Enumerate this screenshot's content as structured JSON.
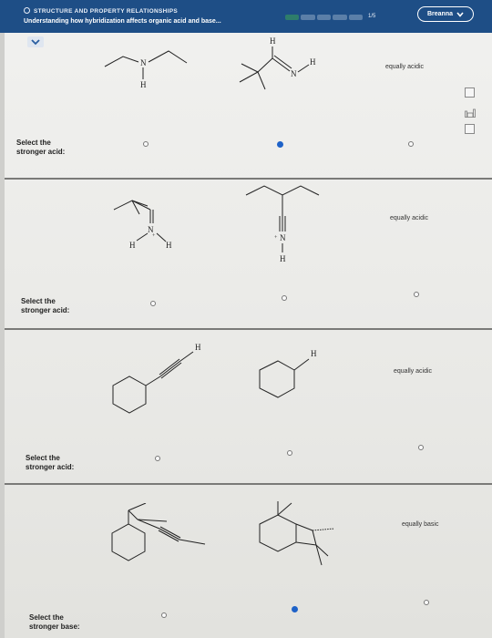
{
  "header": {
    "topic": "STRUCTURE AND PROPERTY RELATIONSHIPS",
    "subtitle": "Understanding how hybridization affects organic acid and base...",
    "progress_value": 0.2,
    "progress_label": "1/5",
    "user_name": "Breanna"
  },
  "questions": [
    {
      "prompt_line1": "Select the",
      "prompt_line2": "stronger acid:",
      "option_c": "equally acidic",
      "selected": "b"
    },
    {
      "prompt_line1": "Select the",
      "prompt_line2": "stronger acid:",
      "option_c": "equally acidic",
      "selected": null
    },
    {
      "prompt_line1": "Select the",
      "prompt_line2": "stronger acid:",
      "option_c": "equally acidic",
      "selected": null
    },
    {
      "prompt_line1": "Select the",
      "prompt_line2": "stronger base:",
      "option_c": "equally basic",
      "selected": "b"
    }
  ],
  "atoms": {
    "N": "N",
    "H": "H",
    "plus": "+"
  },
  "icons": [
    "chevron-down-icon",
    "calculator-icon",
    "periodic-table-icon",
    "grid-icon"
  ]
}
